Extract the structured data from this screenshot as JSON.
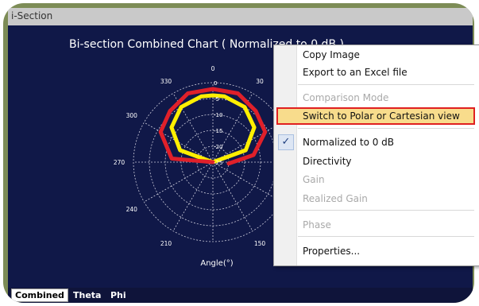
{
  "window": {
    "title": "i-Section"
  },
  "chart": {
    "title": "Bi-section Combined Chart  ( Normalized to 0 dB )",
    "angle_ticks": [
      "0",
      "30",
      "330",
      "300",
      "270",
      "240",
      "210",
      "150"
    ],
    "radial_ticks": [
      "0",
      "-5",
      "-10",
      "-15",
      "-20",
      "-25"
    ],
    "axis_label": "Angle(°)"
  },
  "chart_data": {
    "type": "line",
    "title": "Bi-section Combined Chart  ( Normalized to 0 dB )",
    "xlabel": "Angle(°)",
    "ylabel": "",
    "angle_ticks": [
      0,
      30,
      330,
      300,
      270,
      240,
      210,
      150
    ],
    "radial_ticks": [
      0,
      -5,
      -10,
      -15,
      -20,
      -25
    ],
    "series": [
      {
        "color": "#ffef00",
        "points": [
          [
            270,
            -25
          ],
          [
            290,
            -14
          ],
          [
            310,
            -8
          ],
          [
            330,
            -5
          ],
          [
            350,
            -4
          ],
          [
            0,
            -4
          ],
          [
            10,
            -4
          ],
          [
            30,
            -5
          ],
          [
            50,
            -8
          ],
          [
            70,
            -14
          ],
          [
            90,
            -25
          ]
        ]
      },
      {
        "color": "#e0202a",
        "points": [
          [
            255,
            -25
          ],
          [
            275,
            -12
          ],
          [
            300,
            -6
          ],
          [
            320,
            -4
          ],
          [
            340,
            -2
          ],
          [
            0,
            -2
          ],
          [
            20,
            -2
          ],
          [
            40,
            -4
          ],
          [
            60,
            -6
          ],
          [
            80,
            -12
          ],
          [
            95,
            -20
          ]
        ]
      }
    ]
  },
  "menu": {
    "items": [
      {
        "label": "Copy Image"
      },
      {
        "label": "Export to an Excel file"
      },
      {
        "label": "Comparison Mode"
      },
      {
        "label": "Switch to Polar or Cartesian view"
      },
      {
        "label": "Normalized to 0 dB",
        "checked": true
      },
      {
        "label": "Directivity"
      },
      {
        "label": "Gain"
      },
      {
        "label": "Realized Gain"
      },
      {
        "label": "Phase"
      },
      {
        "label": "Properties..."
      }
    ],
    "check_glyph": "✓"
  },
  "tabs": [
    {
      "label": "Combined"
    },
    {
      "label": "Theta"
    },
    {
      "label": "Phi"
    }
  ]
}
